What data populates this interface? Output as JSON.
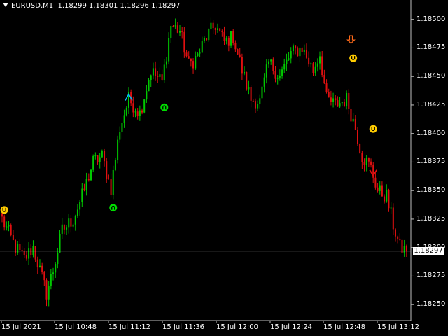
{
  "header": {
    "symbol_timeframe": "EURUSD,M1",
    "ohlc": "1.18299 1.18301 1.18296 1.18297"
  },
  "price_axis": {
    "labels": [
      "1.18500",
      "1.18475",
      "1.18450",
      "1.18425",
      "1.18400",
      "1.18375",
      "1.18350",
      "1.18325",
      "1.18300",
      "1.18275",
      "1.18250"
    ],
    "current_price": "1.18297"
  },
  "time_axis": {
    "labels": [
      "15 Jul 2021",
      "15 Jul 10:48",
      "15 Jul 11:12",
      "15 Jul 11:36",
      "15 Jul 12:00",
      "15 Jul 12:24",
      "15 Jul 12:48",
      "15 Jul 13:12"
    ]
  },
  "colors": {
    "background": "#000000",
    "bull": "#00c800",
    "bear": "#e01010",
    "signal_yellow": "#ffcc00",
    "signal_green": "#00dd00",
    "arrow_cyan": "#00bfff",
    "arrow_orange": "#ff6a1a",
    "line": "#c0c0c0"
  },
  "signals": [
    {
      "type": "yellow-circle",
      "bar": 1,
      "price": 1.18333
    },
    {
      "type": "green-circle",
      "bar": 50,
      "price": 1.18335
    },
    {
      "type": "cyan-up-arrow",
      "bar": 57,
      "price": 1.18432
    },
    {
      "type": "green-circle",
      "bar": 73,
      "price": 1.18423
    },
    {
      "type": "orange-down-arrow",
      "bar": 157,
      "price": 1.18482
    },
    {
      "type": "yellow-circle",
      "bar": 158,
      "price": 1.18466
    },
    {
      "type": "yellow-circle",
      "bar": 167,
      "price": 1.18404
    },
    {
      "type": "red-down-arrow",
      "bar": 167,
      "price": 1.18365
    }
  ],
  "chart_data": {
    "type": "candlestick",
    "ylim": [
      1.18236,
      1.18517
    ],
    "anchors": [
      [
        0,
        1.18325
      ],
      [
        6,
        1.183
      ],
      [
        10,
        1.1829
      ],
      [
        14,
        1.183
      ],
      [
        20,
        1.1826
      ],
      [
        23,
        1.1828
      ],
      [
        27,
        1.18315
      ],
      [
        32,
        1.18325
      ],
      [
        36,
        1.18345
      ],
      [
        41,
        1.18375
      ],
      [
        45,
        1.1838
      ],
      [
        49,
        1.18352
      ],
      [
        53,
        1.18405
      ],
      [
        57,
        1.1843
      ],
      [
        62,
        1.18418
      ],
      [
        67,
        1.18455
      ],
      [
        72,
        1.18445
      ],
      [
        76,
        1.18495
      ],
      [
        80,
        1.1849
      ],
      [
        84,
        1.1846
      ],
      [
        88,
        1.18468
      ],
      [
        92,
        1.18485
      ],
      [
        96,
        1.18495
      ],
      [
        100,
        1.1848
      ],
      [
        104,
        1.18485
      ],
      [
        108,
        1.18455
      ],
      [
        112,
        1.1843
      ],
      [
        116,
        1.18428
      ],
      [
        120,
        1.18462
      ],
      [
        125,
        1.1845
      ],
      [
        130,
        1.1847
      ],
      [
        135,
        1.18475
      ],
      [
        140,
        1.18455
      ],
      [
        143,
        1.1847
      ],
      [
        146,
        1.1843
      ],
      [
        150,
        1.18425
      ],
      [
        155,
        1.1843
      ],
      [
        159,
        1.18405
      ],
      [
        162,
        1.1838
      ],
      [
        166,
        1.1837
      ],
      [
        169,
        1.1835
      ],
      [
        173,
        1.18345
      ],
      [
        176,
        1.1832
      ],
      [
        179,
        1.183
      ],
      [
        182,
        1.18297
      ]
    ]
  }
}
